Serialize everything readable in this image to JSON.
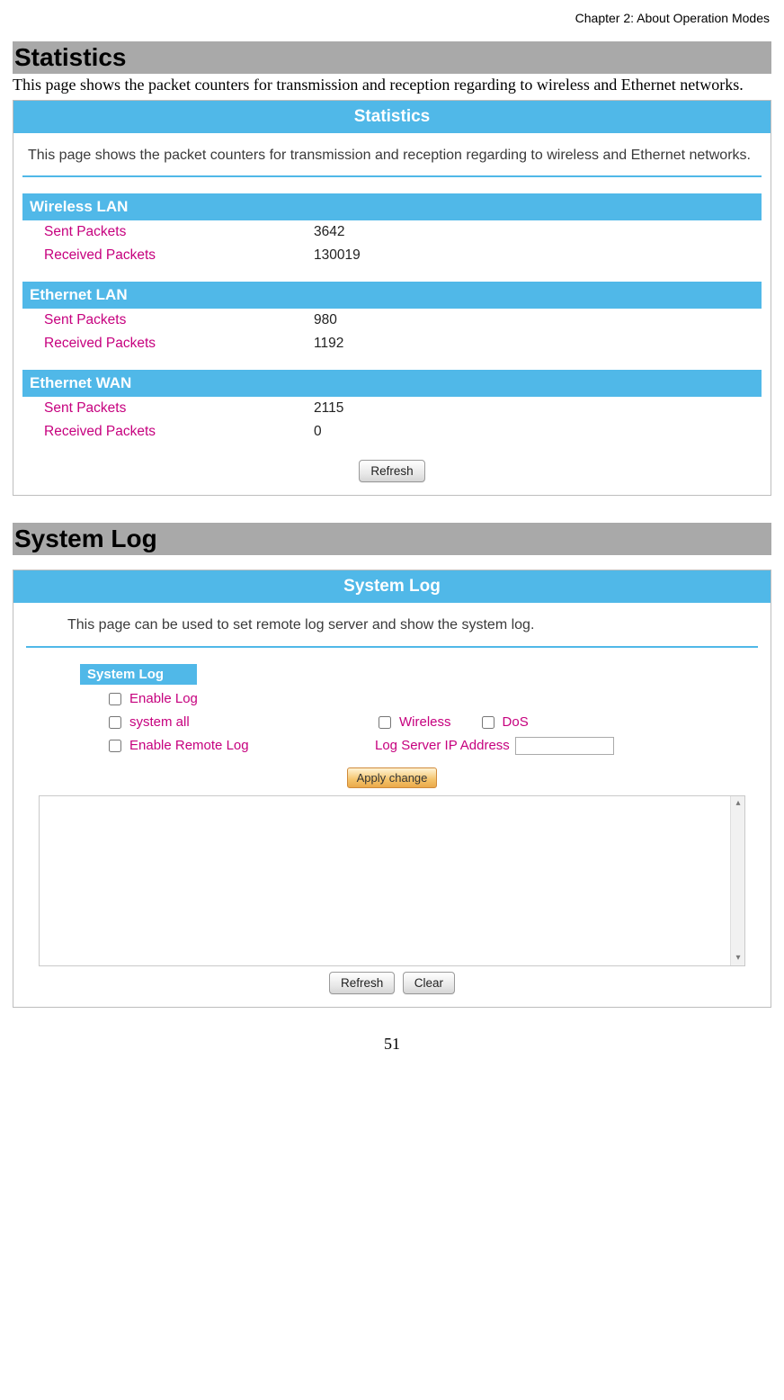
{
  "header": {
    "chapter": "Chapter 2: About Operation Modes"
  },
  "statistics": {
    "title": "Statistics",
    "intro": "This page shows the packet counters for transmission and reception regarding to wireless and Ethernet networks.",
    "banner": "Statistics",
    "desc": "This page shows the packet counters for transmission and reception regarding to wireless and Ethernet networks.",
    "sections": {
      "wlan": {
        "title": "Wireless  LAN",
        "sent_label": "Sent Packets",
        "recv_label": "Received Packets",
        "sent": "3642",
        "recv": "130019"
      },
      "elan": {
        "title": "Ethernet LAN",
        "sent_label": "Sent Packets",
        "recv_label": "Received Packets",
        "sent": "980",
        "recv": "1192"
      },
      "ewan": {
        "title": "Ethernet WAN",
        "sent_label": "Sent Packets",
        "recv_label": "Received Packets",
        "sent": "2115",
        "recv": "0"
      }
    },
    "refresh": "Refresh"
  },
  "syslog": {
    "title": "System Log",
    "banner": "System Log",
    "desc": "This page can be used to set remote log server and show the system log.",
    "box_title": "System Log",
    "enable_log": "Enable Log",
    "system_all": "system all",
    "wireless": "Wireless",
    "dos": "DoS",
    "enable_remote": "Enable Remote Log",
    "ip_label": "Log Server IP Address",
    "apply": "Apply change",
    "refresh": "Refresh",
    "clear": "Clear"
  },
  "page_number": "51"
}
